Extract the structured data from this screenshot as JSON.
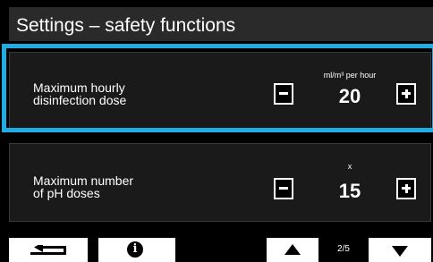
{
  "screen": {
    "title": "Settings – safety functions"
  },
  "settings": [
    {
      "label": "Maximum hourly\ndisinfection dose",
      "label_line1": "Maximum hourly",
      "label_line2": "disinfection dose",
      "unit": "ml/m³ per hour",
      "value": "20",
      "selected": true
    },
    {
      "label": "Maximum number\nof pH doses",
      "label_line1": "Maximum number",
      "label_line2": "of pH doses",
      "unit": "x",
      "value": "15",
      "selected": false
    }
  ],
  "pagination": {
    "page_indicator": "2/5"
  },
  "icons": {
    "back": "back-arrow-icon",
    "info": "info-icon",
    "up": "arrow-up-icon",
    "down": "arrow-down-icon",
    "minus": "minus-icon",
    "plus": "plus-icon"
  },
  "colors": {
    "background": "#000000",
    "selection_highlight": "#1eaee3",
    "row_background": "#1a1a1a",
    "title_background": "#2a2a2a",
    "text": "#ffffff"
  }
}
